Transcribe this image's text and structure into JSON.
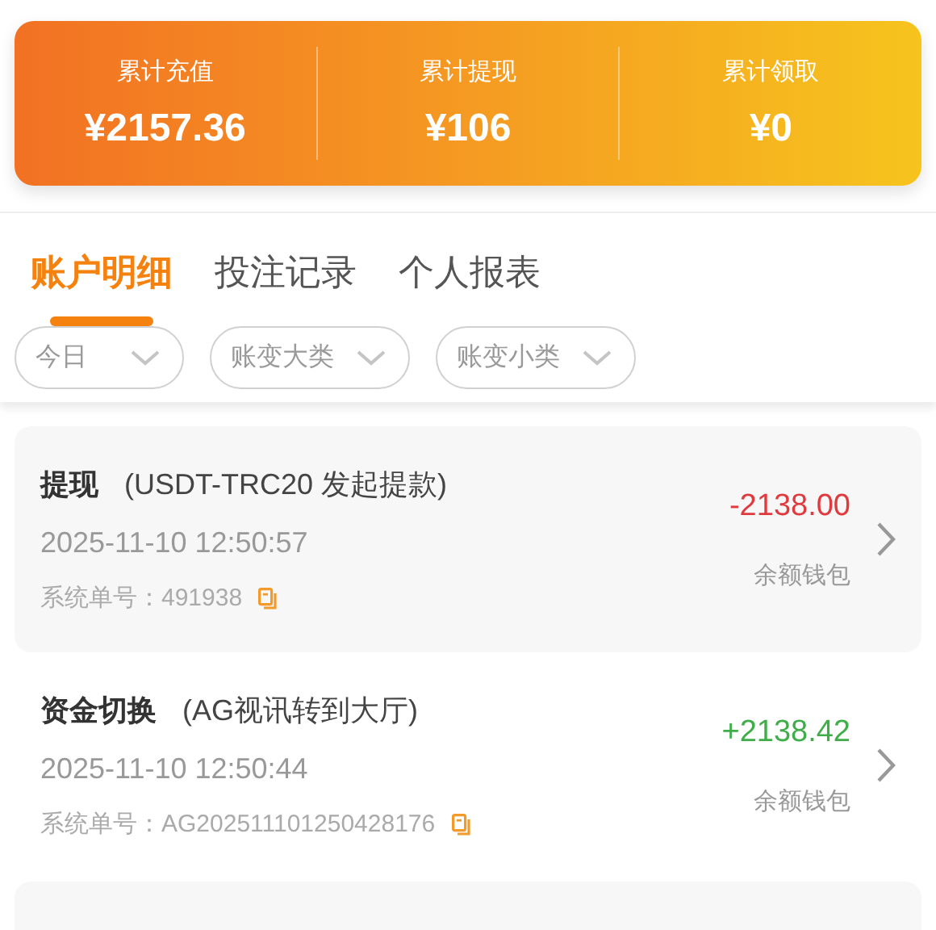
{
  "summary": [
    {
      "label": "累计充值",
      "value": "¥2157.36"
    },
    {
      "label": "累计提现",
      "value": "¥106"
    },
    {
      "label": "累计领取",
      "value": "¥0"
    }
  ],
  "tabs": [
    {
      "label": "账户明细",
      "selected": true
    },
    {
      "label": "投注记录",
      "selected": false
    },
    {
      "label": "个人报表",
      "selected": false
    }
  ],
  "filters": [
    {
      "label": "今日"
    },
    {
      "label": "账变大类"
    },
    {
      "label": "账变小类"
    }
  ],
  "records": [
    {
      "type": "提现",
      "detail": "(USDT-TRC20 发起提款)",
      "time": "2025-11-10 12:50:57",
      "order_label": "系统单号：",
      "order_no": "491938",
      "amount": "-2138.00",
      "color": "#e0393e",
      "wallet": "余额钱包"
    },
    {
      "type": "资金切换",
      "detail": "(AG视讯转到大厅)",
      "time": "2025-11-10 12:50:44",
      "order_label": "系统单号：",
      "order_no": "AG202511101250428176",
      "amount": "+2138.42",
      "color": "#3fae49",
      "wallet": "余额钱包"
    }
  ]
}
